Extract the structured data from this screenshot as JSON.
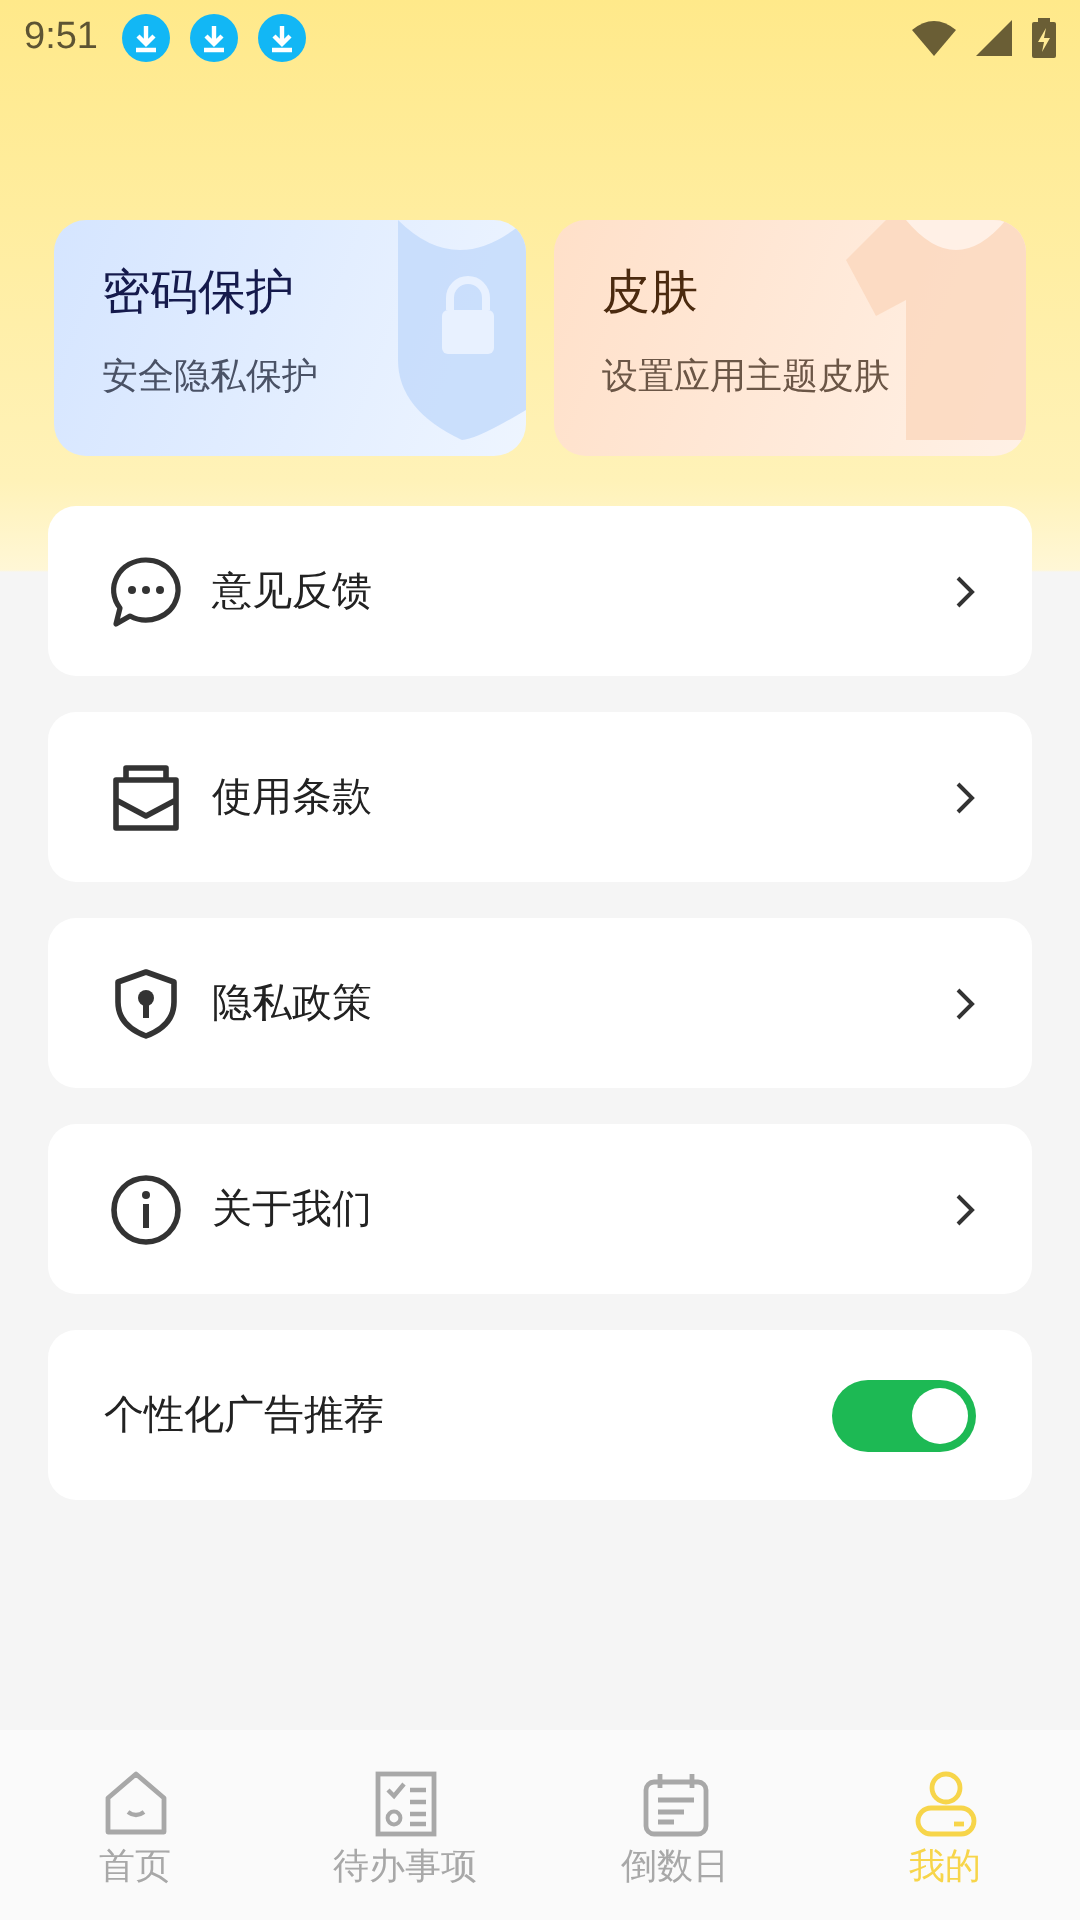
{
  "status_bar": {
    "time": "9:51",
    "notifications": [
      {
        "kind": "download"
      },
      {
        "kind": "download"
      },
      {
        "kind": "download"
      }
    ]
  },
  "cards": [
    {
      "title": "密码保护",
      "subtitle": "安全隐私保护",
      "kind": "lock"
    },
    {
      "title": "皮肤",
      "subtitle": "设置应用主题皮肤",
      "kind": "shirt"
    }
  ],
  "menu": [
    {
      "kind": "link",
      "label": "意见反馈"
    },
    {
      "kind": "link",
      "label": "使用条款"
    },
    {
      "kind": "link",
      "label": "隐私政策"
    },
    {
      "kind": "link",
      "label": "关于我们"
    },
    {
      "kind": "toggle",
      "label": "个性化广告推荐",
      "on": true
    }
  ],
  "tabs": [
    {
      "label": "首页",
      "selected": false
    },
    {
      "label": "待办事项",
      "selected": false
    },
    {
      "label": "倒数日",
      "selected": false
    },
    {
      "label": "我的",
      "selected": true
    }
  ]
}
